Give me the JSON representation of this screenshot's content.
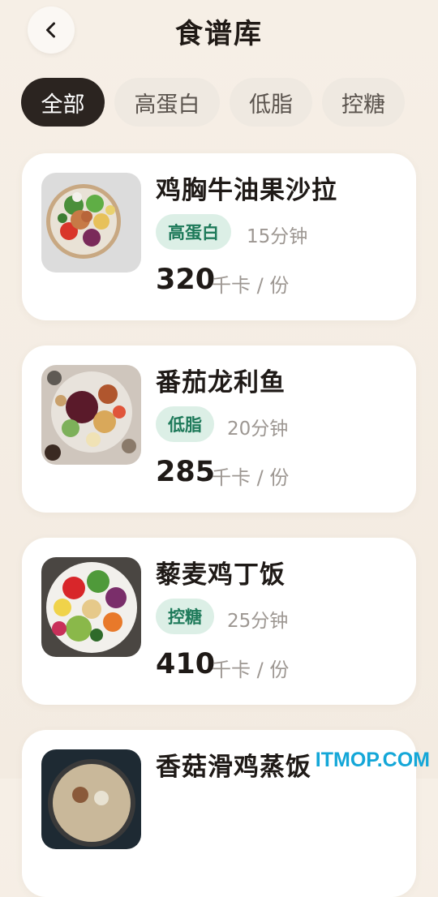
{
  "header": {
    "title": "食谱库",
    "back_icon": "chevron-left-icon"
  },
  "filters": [
    {
      "label": "全部",
      "active": true
    },
    {
      "label": "高蛋白",
      "active": false
    },
    {
      "label": "低脂",
      "active": false
    },
    {
      "label": "控糖",
      "active": false
    }
  ],
  "recipes": [
    {
      "name": "鸡胸牛油果沙拉",
      "tag": "高蛋白",
      "duration": "15分钟",
      "kcal": "320",
      "unit": "千卡 / 份",
      "image": "salad-bowl-photo"
    },
    {
      "name": "番茄龙利鱼",
      "tag": "低脂",
      "duration": "20分钟",
      "kcal": "285",
      "unit": "千卡 / 份",
      "image": "platter-photo"
    },
    {
      "name": "藜麦鸡丁饭",
      "tag": "控糖",
      "duration": "25分钟",
      "kcal": "410",
      "unit": "千卡 / 份",
      "image": "veggie-plate-photo"
    },
    {
      "name": "香菇滑鸡蒸饭",
      "image": "rice-bowl-photo"
    }
  ],
  "colors": {
    "background": "#f6efe6",
    "active_chip": "#2b2420",
    "tag_bg": "#dcefe6",
    "tag_text": "#1e7a5a",
    "watermark": "#14a7d8"
  },
  "watermark": "ITMOP.COM"
}
